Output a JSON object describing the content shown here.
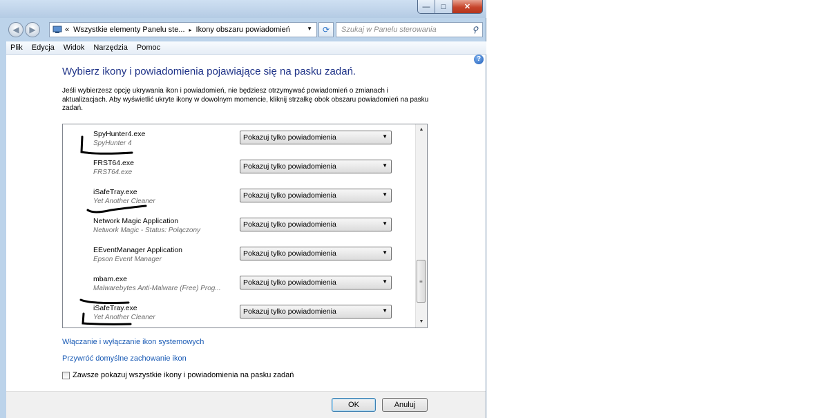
{
  "window": {
    "caption_buttons": {
      "minimize": "—",
      "maximize": "□",
      "close": "✕"
    }
  },
  "nav": {
    "back_icon": "◀",
    "forward_icon": "▶",
    "breadcrumb": [
      "Wszystkie elementy Panelu ste...",
      "Ikony obszaru powiadomień"
    ],
    "breadcrumb_prefix": "«",
    "separator": "▸",
    "dropdown": "▼",
    "refresh_icon": "⟳",
    "search_placeholder": "Szukaj w Panelu sterowania",
    "search_icon": "⚲"
  },
  "menu": [
    "Plik",
    "Edycja",
    "Widok",
    "Narzędzia",
    "Pomoc"
  ],
  "help_icon": "?",
  "page": {
    "title": "Wybierz ikony i powiadomienia pojawiające się na pasku zadań.",
    "intro": "Jeśli wybierzesz opcję ukrywania ikon i powiadomień, nie będziesz otrzymywać powiadomień o zmianach i aktualizacjach. Aby wyświetlić ukryte ikony w dowolnym momencie, kliknij strzałkę obok obszaru powiadomień na pasku zadań."
  },
  "icons_list": [
    {
      "name": "SpyHunter4.exe",
      "description": "SpyHunter 4",
      "behavior": "Pokazuj tylko powiadomienia"
    },
    {
      "name": "FRST64.exe",
      "description": "FRST64.exe",
      "behavior": "Pokazuj tylko powiadomienia"
    },
    {
      "name": "iSafeTray.exe",
      "description": "Yet Another Cleaner",
      "behavior": "Pokazuj tylko powiadomienia"
    },
    {
      "name": "Network Magic Application",
      "description": "Network Magic - Status: Połączony",
      "behavior": "Pokazuj tylko powiadomienia"
    },
    {
      "name": "EEventManager Application",
      "description": "Epson Event Manager",
      "behavior": "Pokazuj tylko powiadomienia"
    },
    {
      "name": "mbam.exe",
      "description": "Malwarebytes Anti-Malware (Free)  Prog...",
      "behavior": "Pokazuj tylko powiadomienia"
    },
    {
      "name": "iSafeTray.exe",
      "description": "Yet Another Cleaner",
      "behavior": "Pokazuj tylko powiadomienia"
    }
  ],
  "select_arrow": "▼",
  "scroll": {
    "up": "▲",
    "down": "▼",
    "grip": "≡"
  },
  "links": {
    "system_icons": "Włączanie i wyłączanie ikon systemowych",
    "restore_default": "Przywróć domyślne zachowanie ikon"
  },
  "always_show": {
    "label": "Zawsze pokazuj wszystkie ikony i powiadomienia na pasku zadań",
    "checked": false
  },
  "buttons": {
    "ok": "OK",
    "cancel": "Anuluj"
  }
}
